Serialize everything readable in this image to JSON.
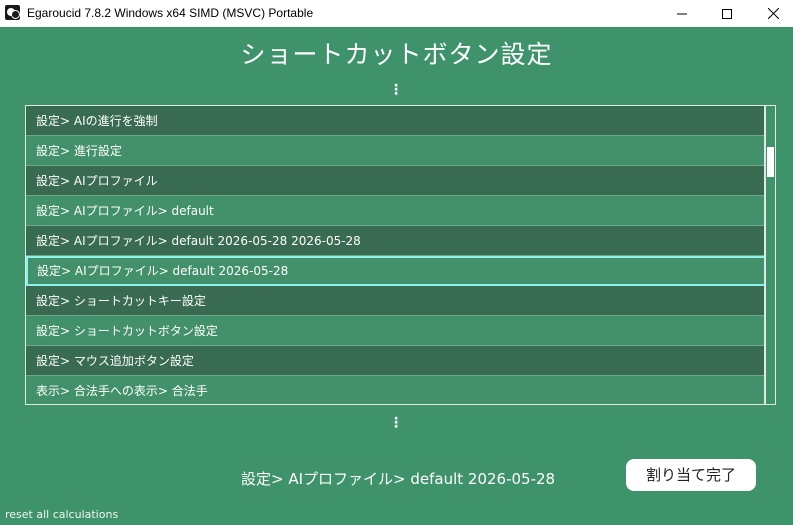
{
  "window": {
    "title": "Egaroucid 7.8.2 Windows x64 SIMD (MSVC) Portable",
    "icon": "egaroucid-app-icon"
  },
  "page": {
    "title": "ショートカットボタン設定",
    "more_above_icon": "⋮",
    "more_below_icon": "⋮"
  },
  "list": {
    "items": [
      {
        "label": "設定> AIの進行を強制",
        "tone": "dark"
      },
      {
        "label": "設定> 進行設定",
        "tone": "light"
      },
      {
        "label": "設定> AIプロファイル",
        "tone": "dark"
      },
      {
        "label": "設定> AIプロファイル> default",
        "tone": "light"
      },
      {
        "label": "設定> AIプロファイル> default 2026-05-28 2026-05-28",
        "tone": "dark"
      },
      {
        "label": "設定> AIプロファイル> default 2026-05-28",
        "tone": "light",
        "selected": true
      },
      {
        "label": "設定> ショートカットキー設定",
        "tone": "dark"
      },
      {
        "label": "設定> ショートカットボタン設定",
        "tone": "light"
      },
      {
        "label": "設定> マウス追加ボタン設定",
        "tone": "dark"
      },
      {
        "label": "表示> 合法手への表示> 合法手",
        "tone": "light"
      }
    ]
  },
  "footer": {
    "current_selection": "設定> AIプロファイル> default 2026-05-28",
    "done_button": "割り当て完了",
    "reset_link": "reset all calculations"
  },
  "colors": {
    "background": "#3f936b",
    "row_dark": "#386b52",
    "row_light": "#43916a",
    "selection_border": "#8df2ea"
  }
}
